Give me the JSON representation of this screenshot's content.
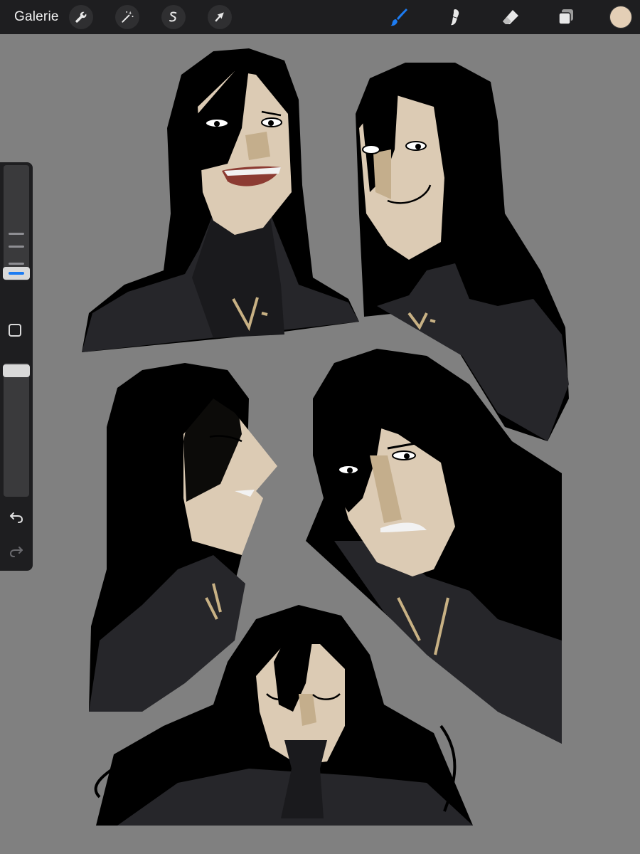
{
  "topbar": {
    "gallery_label": "Galerie",
    "actions": [
      {
        "name": "wrench-icon",
        "label": ""
      },
      {
        "name": "magic-wand-icon",
        "label": ""
      },
      {
        "name": "selection-icon",
        "label": ""
      },
      {
        "name": "transform-arrow-icon",
        "label": ""
      }
    ],
    "tools": {
      "brush": {
        "icon": "brush-icon",
        "active": true
      },
      "smudge": {
        "icon": "smudge-icon",
        "active": false
      },
      "eraser": {
        "icon": "eraser-icon",
        "active": false
      },
      "layers": {
        "icon": "layers-icon",
        "active": false
      }
    },
    "current_color": "#e4cfb6"
  },
  "sidebar": {
    "brush_size_level": 0.58,
    "opacity_level": 0.9,
    "modifier_icon": "square-modifier-icon",
    "undo_icon": "undo-icon",
    "redo_icon": "redo-icon"
  },
  "canvas": {
    "description_icon": "artwork",
    "colors": {
      "background": "#808080",
      "hair": "#000000",
      "skin": "#dccbb4",
      "coat": "#26262a",
      "coat_shade": "#1a1a1d",
      "gold": "#c8b184",
      "mouth": "#8c3b32",
      "accent": "#1d7cf2"
    }
  }
}
